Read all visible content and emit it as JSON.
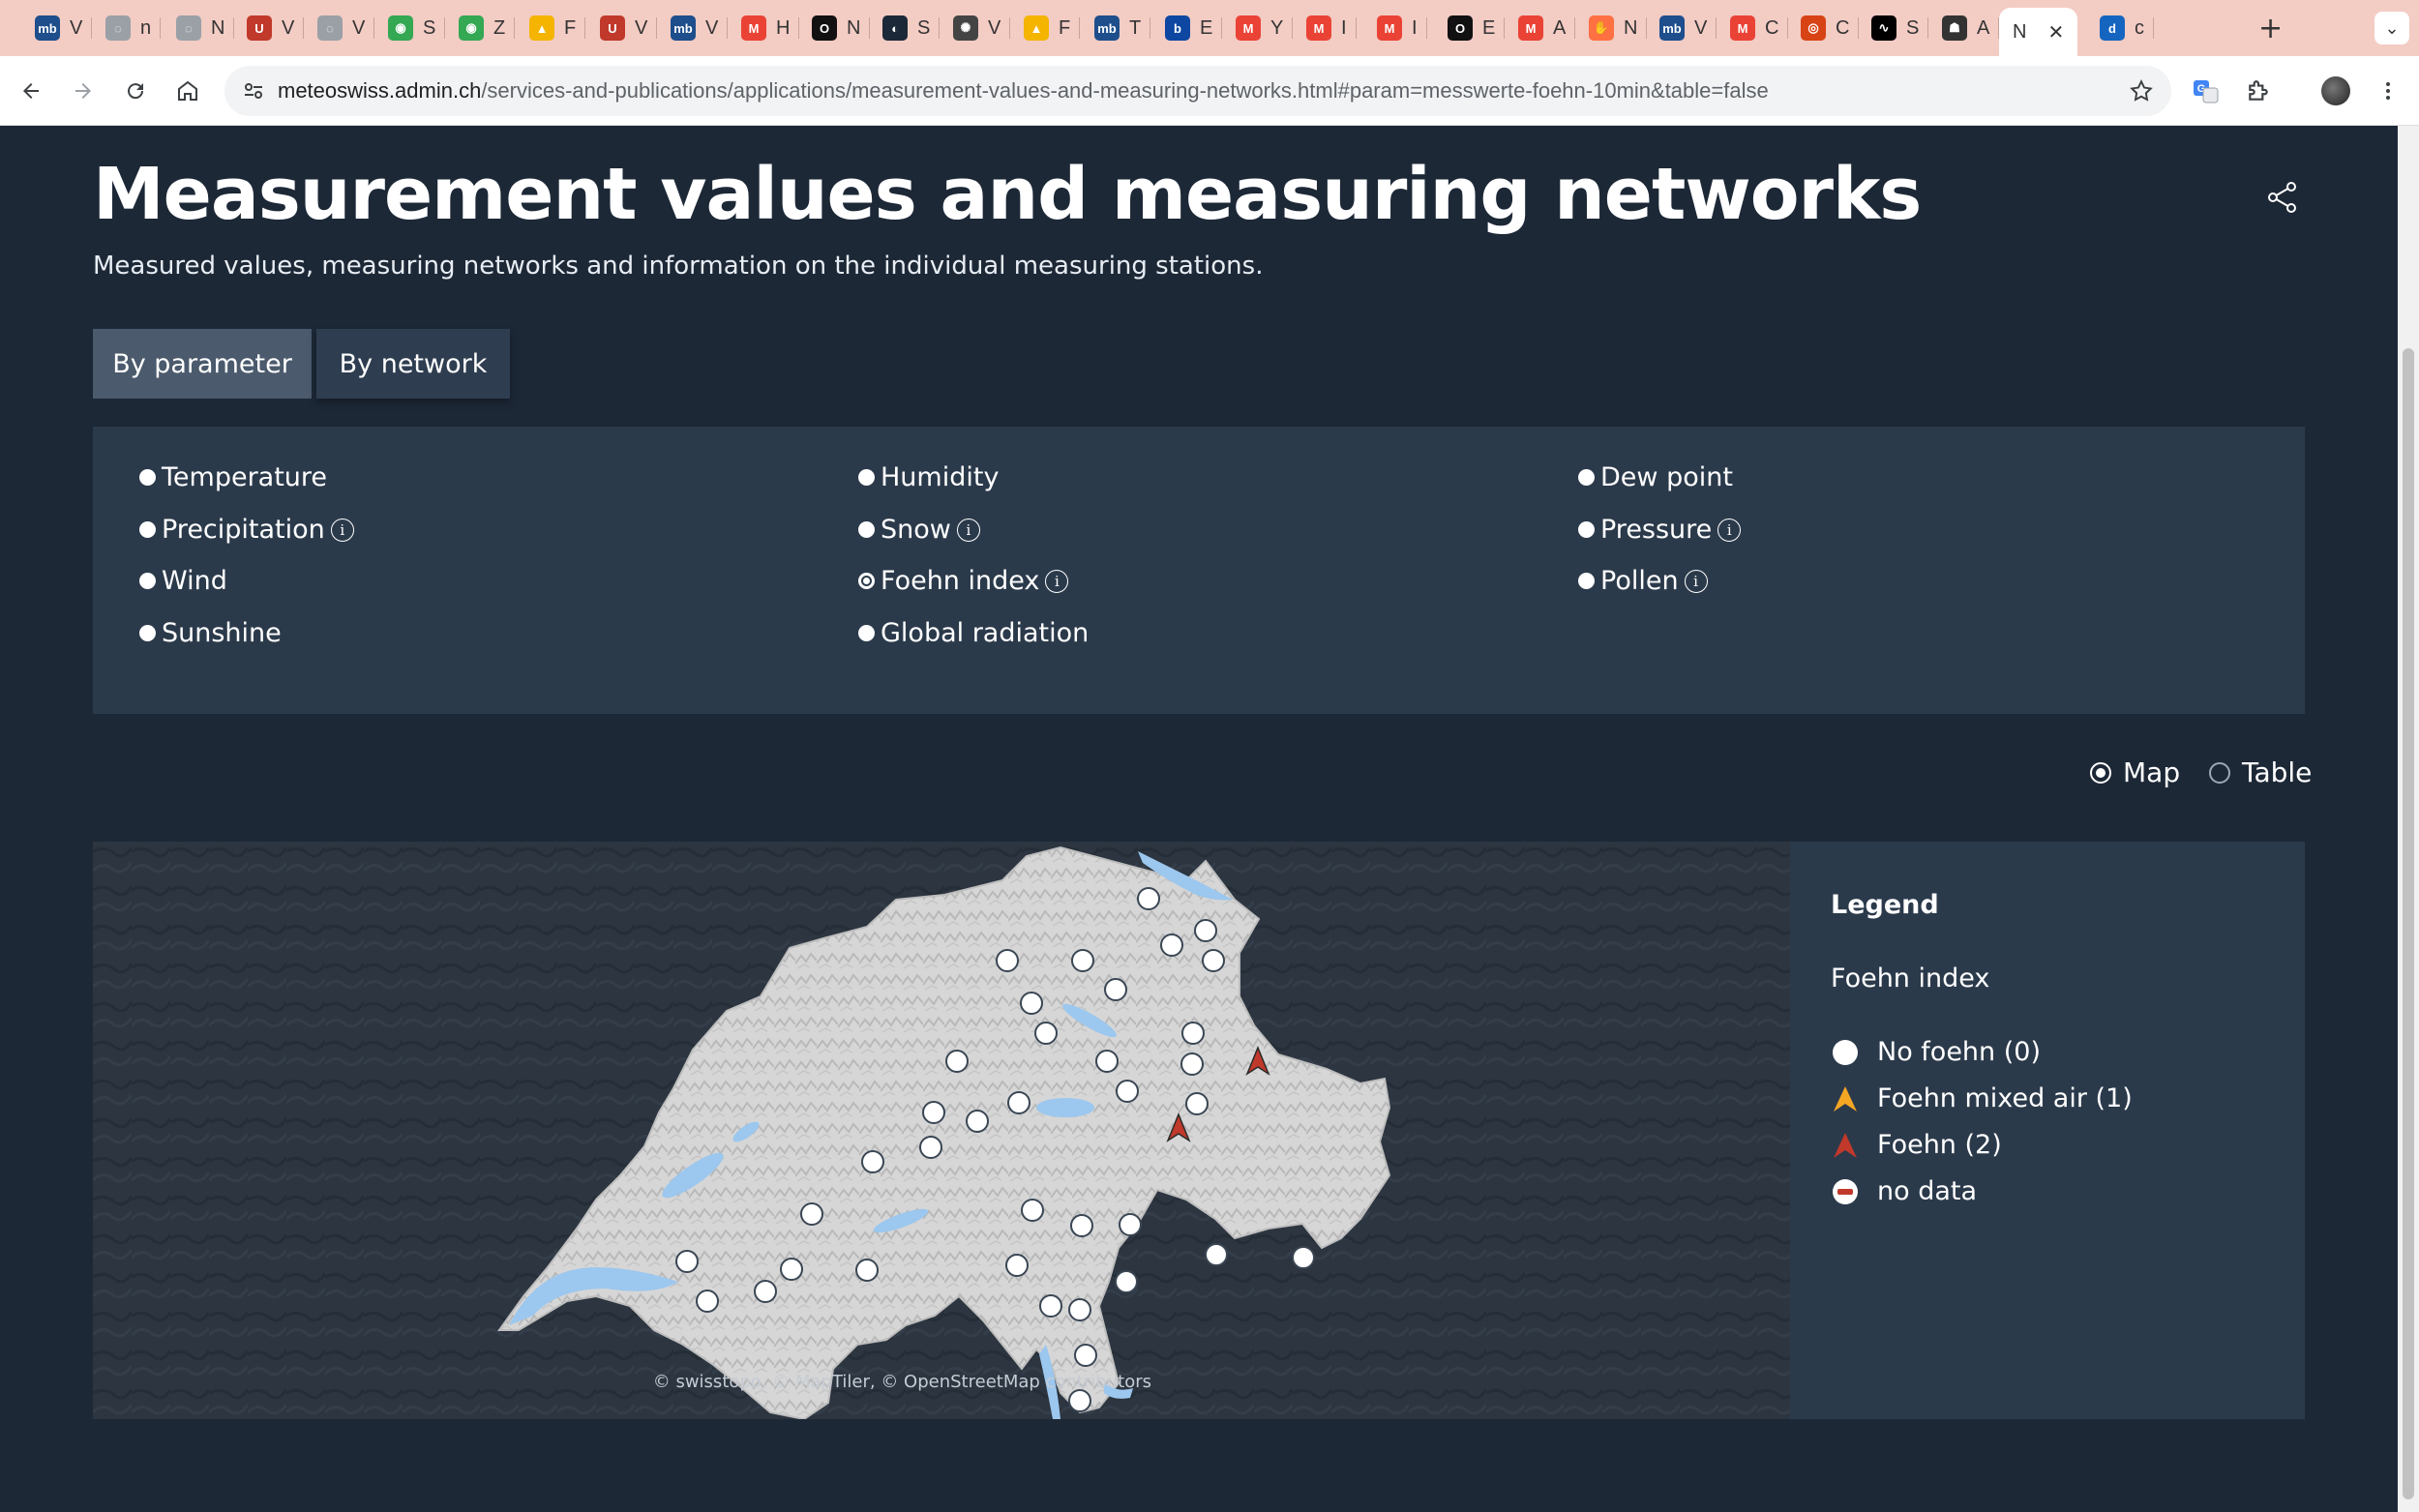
{
  "browser": {
    "tabs": [
      {
        "icon": "mb",
        "label": "V",
        "color": "#1e4e8c"
      },
      {
        "icon": "globe",
        "label": "n",
        "color": "#9aa0a6"
      },
      {
        "icon": "globe",
        "label": "N",
        "color": "#9aa0a6"
      },
      {
        "icon": "U",
        "label": "V",
        "color": "#c0392b"
      },
      {
        "icon": "globe",
        "label": "V",
        "color": "#9aa0a6"
      },
      {
        "icon": "maps",
        "label": "S",
        "color": "#34a853"
      },
      {
        "icon": "maps",
        "label": "Z",
        "color": "#34a853"
      },
      {
        "icon": "drive",
        "label": "F",
        "color": "#f4b400"
      },
      {
        "icon": "U",
        "label": "V",
        "color": "#c0392b"
      },
      {
        "icon": "mb",
        "label": "V",
        "color": "#1e4e8c"
      },
      {
        "icon": "M",
        "label": "H",
        "color": "#ea4335"
      },
      {
        "icon": "O",
        "label": "N",
        "color": "#111111"
      },
      {
        "icon": "steam",
        "label": "S",
        "color": "#1b2838"
      },
      {
        "icon": "ai",
        "label": "V",
        "color": "#444444"
      },
      {
        "icon": "drive",
        "label": "F",
        "color": "#f4b400"
      },
      {
        "icon": "mb",
        "label": "T",
        "color": "#1e4e8c"
      },
      {
        "icon": "b",
        "label": "E",
        "color": "#0d47a1"
      },
      {
        "icon": "M",
        "label": "Y",
        "color": "#ea4335"
      },
      {
        "icon": "M",
        "label": "I",
        "color": "#ea4335"
      },
      {
        "icon": "M",
        "label": "I",
        "color": "#ea4335"
      },
      {
        "icon": "O",
        "label": "E",
        "color": "#111111"
      },
      {
        "icon": "M",
        "label": "A",
        "color": "#ea4335"
      },
      {
        "icon": "hand",
        "label": "N",
        "color": "#ff7043"
      },
      {
        "icon": "mb",
        "label": "V",
        "color": "#1e4e8c"
      },
      {
        "icon": "M",
        "label": "C",
        "color": "#ea4335"
      },
      {
        "icon": "ring",
        "label": "C",
        "color": "#d84315"
      },
      {
        "icon": "wave",
        "label": "S",
        "color": "#000000"
      },
      {
        "icon": "hat",
        "label": "A",
        "color": "#333333"
      },
      {
        "icon": "",
        "label": "N",
        "color": "#ffffff",
        "active": true
      },
      {
        "icon": "d",
        "label": "c",
        "color": "#1565c0"
      }
    ],
    "url_host": "meteoswiss.admin.ch",
    "url_rest": "/services-and-publications/applications/measurement-values-and-measuring-networks.html#param=messwerte-foehn-10min&table=false"
  },
  "page": {
    "title": "Measurement values and measuring networks",
    "subtitle": "Measured values, measuring networks and information on the individual measuring stations.",
    "tabs": {
      "by_parameter": "By parameter",
      "by_network": "By network"
    },
    "parameters": [
      {
        "label": "Temperature",
        "info": false,
        "selected": false
      },
      {
        "label": "Humidity",
        "info": false,
        "selected": false
      },
      {
        "label": "Dew point",
        "info": false,
        "selected": false
      },
      {
        "label": "Precipitation",
        "info": true,
        "selected": false
      },
      {
        "label": "Snow",
        "info": true,
        "selected": false
      },
      {
        "label": "Pressure",
        "info": true,
        "selected": false
      },
      {
        "label": "Wind",
        "info": false,
        "selected": false
      },
      {
        "label": "Foehn index",
        "info": true,
        "selected": true
      },
      {
        "label": "Pollen",
        "info": true,
        "selected": false
      },
      {
        "label": "Sunshine",
        "info": false,
        "selected": false
      },
      {
        "label": "Global radiation",
        "info": false,
        "selected": false
      }
    ],
    "view": {
      "map": "Map",
      "table": "Table",
      "selected": "map"
    },
    "legend": {
      "title": "Legend",
      "subtitle": "Foehn index",
      "items": [
        {
          "label": "No foehn (0)",
          "symbol": "circle",
          "color": "#ffffff"
        },
        {
          "label": "Foehn mixed air (1)",
          "symbol": "arrow",
          "color": "#f5a623"
        },
        {
          "label": "Foehn (2)",
          "symbol": "arrow",
          "color": "#c0392b"
        },
        {
          "label": "no data",
          "symbol": "nodata",
          "color": "#c0392b"
        }
      ]
    },
    "attribution": "© swisstopo, © MapTiler, © OpenStreetMap contributors",
    "map_controls": {
      "zoom_in": "zoom-in",
      "zoom_out": "zoom-out",
      "reset": "switzerland-extent"
    },
    "info_glyph": "i"
  }
}
